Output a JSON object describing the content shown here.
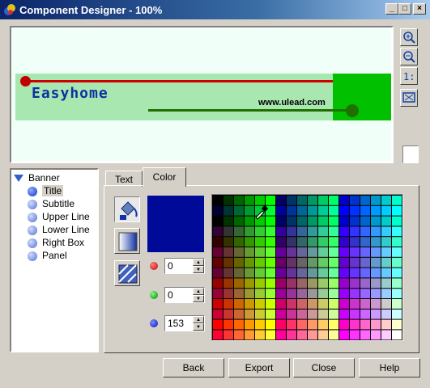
{
  "window": {
    "title": "Component Designer - 100%"
  },
  "preview": {
    "banner_title": "Easyhome",
    "banner_subtitle": "www.ulead.com"
  },
  "side_tools": [
    "zoom-in-icon",
    "zoom-out-icon",
    "actual-size-icon",
    "fit-icon"
  ],
  "tree": {
    "root": "Banner",
    "items": [
      {
        "label": "Title",
        "selected": true
      },
      {
        "label": "Subtitle"
      },
      {
        "label": "Upper Line"
      },
      {
        "label": "Lower Line"
      },
      {
        "label": "Right Box"
      },
      {
        "label": "Panel"
      }
    ]
  },
  "tabs": {
    "text": "Text",
    "color": "Color",
    "active": "Color"
  },
  "color": {
    "current": "#000a99",
    "red": "0",
    "green": "0",
    "blue": "153"
  },
  "buttons": {
    "back": "Back",
    "export": "Export",
    "close": "Close",
    "help": "Help"
  }
}
